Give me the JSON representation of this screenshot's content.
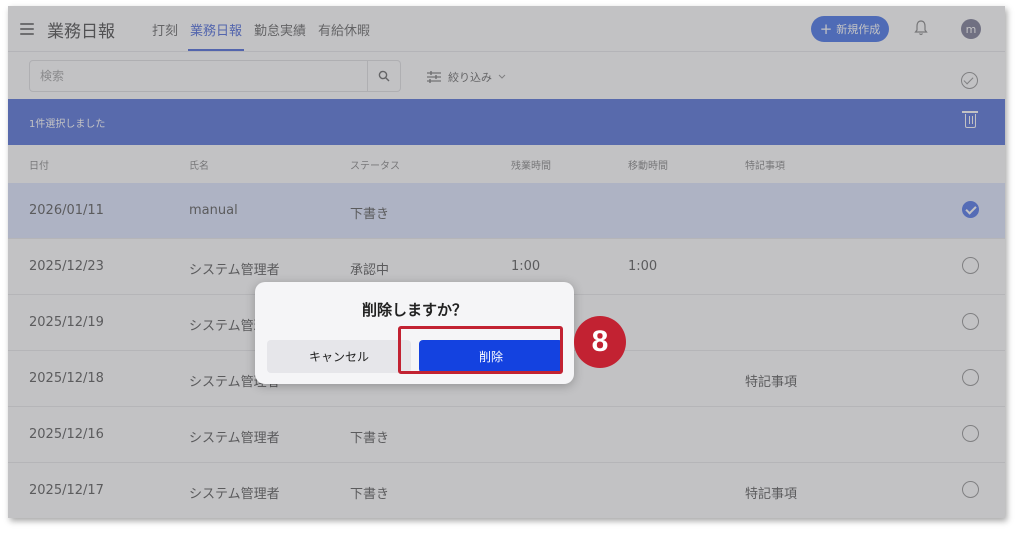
{
  "header": {
    "title": "業務日報",
    "nav": [
      {
        "label": "打刻"
      },
      {
        "label": "業務日報",
        "active": true
      },
      {
        "label": "勤怠実績"
      },
      {
        "label": "有給休暇"
      }
    ],
    "new_button_label": "新規作成",
    "avatar_initial": "m"
  },
  "toolbar": {
    "search_placeholder": "検索",
    "filter_label": "絞り込み"
  },
  "selection_bar": {
    "text": "1件選択しました"
  },
  "table": {
    "columns": [
      "日付",
      "氏名",
      "ステータス",
      "残業時間",
      "移動時間",
      "特記事項"
    ],
    "rows": [
      {
        "date": "2026/01/11",
        "name": "manual",
        "status": "下書き",
        "overtime": "",
        "travel": "",
        "note": "",
        "selected": true
      },
      {
        "date": "2025/12/23",
        "name": "システム管理者",
        "status": "承認中",
        "overtime": "1:00",
        "travel": "1:00",
        "note": "",
        "selected": false
      },
      {
        "date": "2025/12/19",
        "name": "システム管理者",
        "status": "",
        "overtime": "",
        "travel": "",
        "note": "",
        "selected": false
      },
      {
        "date": "2025/12/18",
        "name": "システム管理者",
        "status": "",
        "overtime": "",
        "travel": "",
        "note": "特記事項",
        "selected": false
      },
      {
        "date": "2025/12/16",
        "name": "システム管理者",
        "status": "下書き",
        "overtime": "",
        "travel": "",
        "note": "",
        "selected": false
      },
      {
        "date": "2025/12/17",
        "name": "システム管理者",
        "status": "下書き",
        "overtime": "",
        "travel": "",
        "note": "特記事項",
        "selected": false
      }
    ]
  },
  "dialog": {
    "title": "削除しますか？",
    "cancel_label": "キャンセル",
    "delete_label": "削除"
  },
  "annotation": {
    "step_number": "8"
  },
  "colors": {
    "accent": "#3557d6",
    "highlight": "#c22232",
    "delete_button": "#1442e0"
  }
}
